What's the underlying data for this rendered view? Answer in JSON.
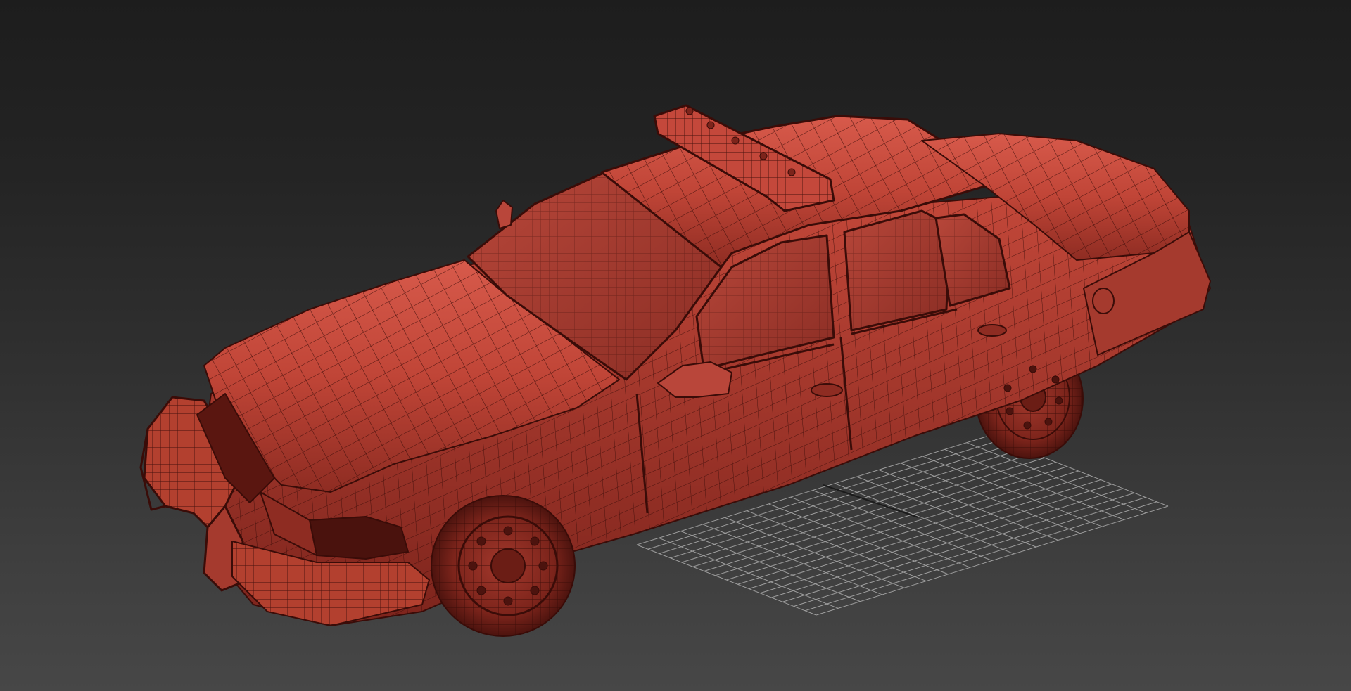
{
  "viewport": {
    "background_top": "#1d1d1d",
    "background_bottom": "#474747"
  },
  "scene": {
    "object": "police-car-wireframe-model",
    "shading": "wireframe-on-shaded",
    "body_color": "#c4483b",
    "wire_color": "#3a0c08",
    "grid_color": "#bdbdbd"
  }
}
